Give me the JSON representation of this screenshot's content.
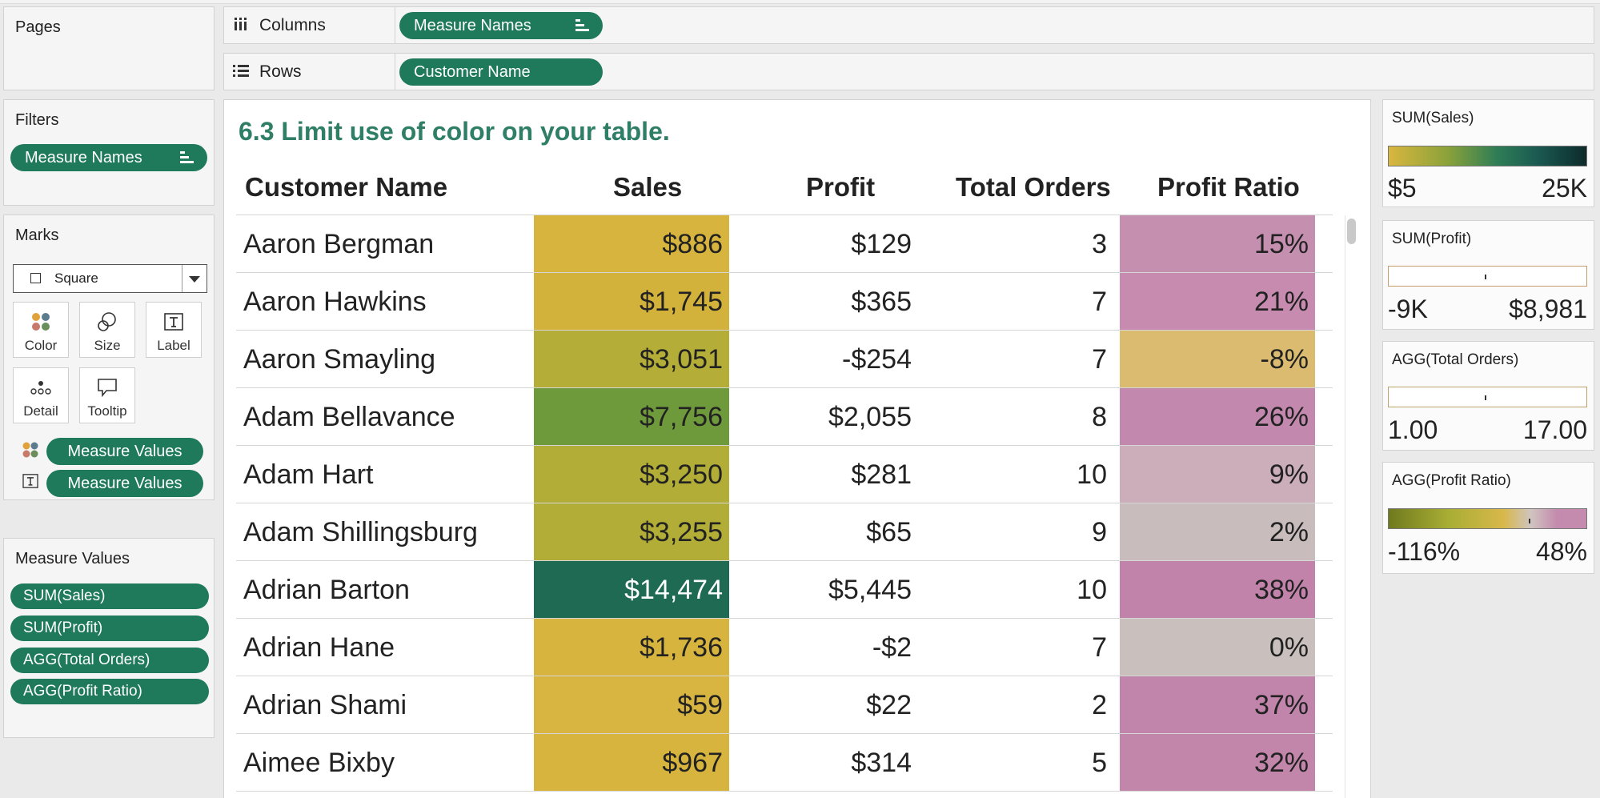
{
  "shelves": {
    "columns": {
      "label": "Columns",
      "pill": "Measure Names"
    },
    "rows": {
      "label": "Rows",
      "pill": "Customer Name"
    }
  },
  "pages": {
    "title": "Pages"
  },
  "filters": {
    "title": "Filters",
    "pill": "Measure Names"
  },
  "marks": {
    "title": "Marks",
    "type": "Square",
    "cards": [
      "Color",
      "Size",
      "Label",
      "Detail",
      "Tooltip"
    ],
    "color_pill": "Measure Values",
    "label_pill": "Measure Values"
  },
  "measure_values": {
    "title": "Measure Values",
    "items": [
      "SUM(Sales)",
      "SUM(Profit)",
      "AGG(Total Orders)",
      "AGG(Profit Ratio)"
    ]
  },
  "sheet": {
    "title": "6.3 Limit use of color on your table.",
    "headers": [
      "Customer Name",
      "Sales",
      "Profit",
      "Total Orders",
      "Profit Ratio"
    ],
    "rows": [
      {
        "name": "Aaron Bergman",
        "sales": "$886",
        "profit": "$129",
        "orders": "3",
        "ratio": "15%",
        "sales_color": "#d6b43e",
        "ratio_color": "#c58fb0",
        "sales_text": "#222"
      },
      {
        "name": "Aaron Hawkins",
        "sales": "$1,745",
        "profit": "$365",
        "orders": "7",
        "ratio": "21%",
        "sales_color": "#d3b23c",
        "ratio_color": "#c68bae",
        "sales_text": "#222"
      },
      {
        "name": "Aaron Smayling",
        "sales": "$3,051",
        "profit": "-$254",
        "orders": "7",
        "ratio": "-8%",
        "sales_color": "#b4ae38",
        "ratio_color": "#dbbb70",
        "sales_text": "#222"
      },
      {
        "name": "Adam Bellavance",
        "sales": "$7,756",
        "profit": "$2,055",
        "orders": "8",
        "ratio": "26%",
        "sales_color": "#6f9a3c",
        "ratio_color": "#c388ad",
        "sales_text": "#222"
      },
      {
        "name": "Adam Hart",
        "sales": "$3,250",
        "profit": "$281",
        "orders": "10",
        "ratio": "9%",
        "sales_color": "#b2ad37",
        "ratio_color": "#cbaeba",
        "sales_text": "#222"
      },
      {
        "name": "Adam Shillingsburg",
        "sales": "$3,255",
        "profit": "$65",
        "orders": "9",
        "ratio": "2%",
        "sales_color": "#b2ad37",
        "ratio_color": "#c8bcbc",
        "sales_text": "#222"
      },
      {
        "name": "Adrian Barton",
        "sales": "$14,474",
        "profit": "$5,445",
        "orders": "10",
        "ratio": "38%",
        "sales_color": "#1e6a52",
        "ratio_color": "#c183aa",
        "sales_text": "#ffffff"
      },
      {
        "name": "Adrian Hane",
        "sales": "$1,736",
        "profit": "-$2",
        "orders": "7",
        "ratio": "0%",
        "sales_color": "#d6b43e",
        "ratio_color": "#c9c0bd",
        "sales_text": "#222"
      },
      {
        "name": "Adrian Shami",
        "sales": "$59",
        "profit": "$22",
        "orders": "2",
        "ratio": "37%",
        "sales_color": "#d8b540",
        "ratio_color": "#c184aa",
        "sales_text": "#222"
      },
      {
        "name": "Aimee Bixby",
        "sales": "$967",
        "profit": "$314",
        "orders": "5",
        "ratio": "32%",
        "sales_color": "#d6b43e",
        "ratio_color": "#c286ab",
        "sales_text": "#222"
      }
    ]
  },
  "legends": [
    {
      "title": "SUM(Sales)",
      "min": "$5",
      "max": "25K",
      "gradient": [
        "#d9b63f",
        "#8aa23a",
        "#2e7d56",
        "#1b5a52",
        "#0d2b2b"
      ],
      "outline": false
    },
    {
      "title": "SUM(Profit)",
      "min": "-9K",
      "max": "$8,981",
      "outline": true,
      "outline_color": "#c59c6c"
    },
    {
      "title": "AGG(Total Orders)",
      "min": "1.00",
      "max": "17.00",
      "outline": true,
      "outline_color": "#b9a56b"
    },
    {
      "title": "AGG(Profit Ratio)",
      "min": "-116%",
      "max": "48%",
      "gradient": [
        "#6f7a1e",
        "#a8ad34",
        "#d8b84a",
        "#cfc4c0",
        "#c48bae"
      ],
      "outline": false
    }
  ],
  "colors": {
    "accent": "#1f7a5c",
    "title_green": "#2f7e66"
  }
}
